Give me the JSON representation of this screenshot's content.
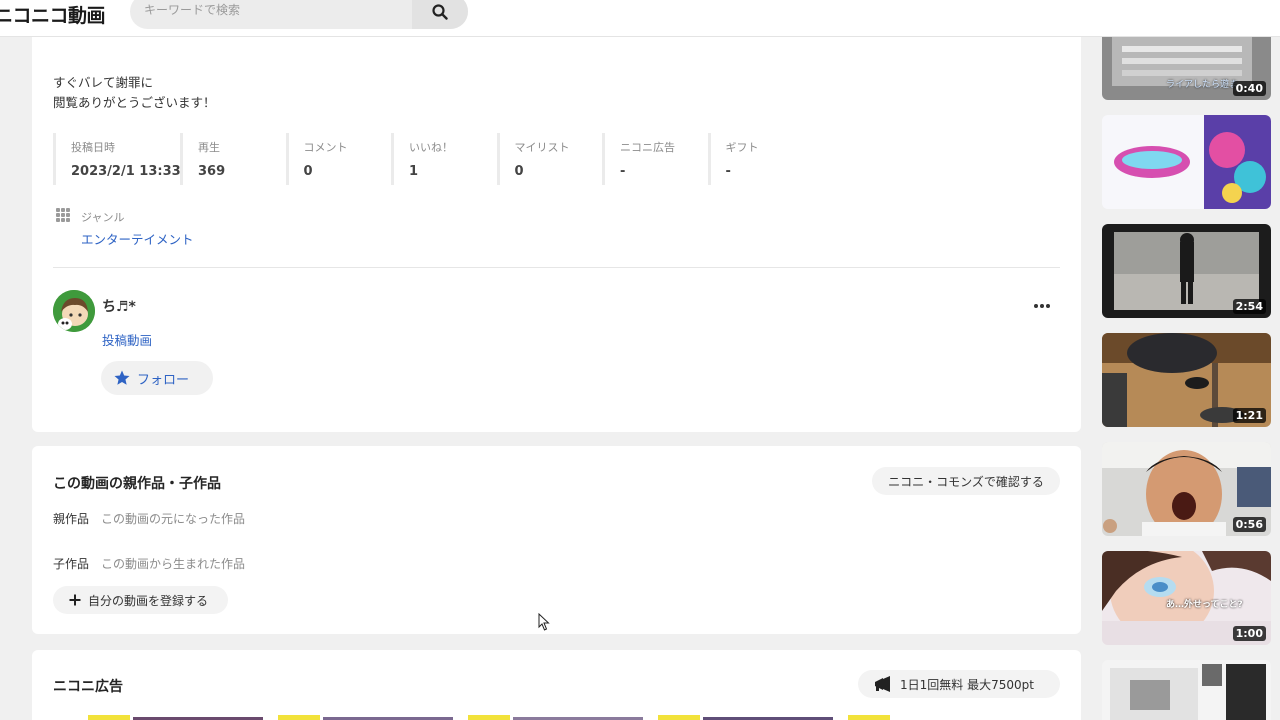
{
  "header": {
    "logo": "ニコニコ動画",
    "search_placeholder": "キーワードで検索"
  },
  "video": {
    "description": [
      "すぐバレて謝罪に",
      "閲覧ありがとうございます！"
    ],
    "stats": [
      {
        "label": "投稿日時",
        "value": "2023/2/1 13:33"
      },
      {
        "label": "再生",
        "value": "369"
      },
      {
        "label": "コメント",
        "value": "0"
      },
      {
        "label": "いいね！",
        "value": "1"
      },
      {
        "label": "マイリスト",
        "value": "0"
      },
      {
        "label": "ニコニ広告",
        "value": "-"
      },
      {
        "label": "ギフト",
        "value": "-"
      }
    ],
    "genre_label": "ジャンル",
    "genre": "エンターテイメント"
  },
  "owner": {
    "name": "ち♬*",
    "videos_link": "投稿動画",
    "follow_label": "フォロー"
  },
  "relations": {
    "title": "この動画の親作品・子作品",
    "commons_button": "ニコニ・コモンズで確認する",
    "parent_label": "親作品",
    "parent_desc": "この動画の元になった作品",
    "child_label": "子作品",
    "child_desc": "この動画から生まれた作品",
    "register_button": "自分の動画を登録する"
  },
  "nicoad": {
    "title": "ニコニ広告",
    "button": "1日1回無料 最大7500pt"
  },
  "sidebar_videos": [
    {
      "duration": "0:40",
      "overlay": "ライアしたら遊ま"
    },
    {
      "duration": "",
      "overlay": ""
    },
    {
      "duration": "2:54",
      "overlay": ""
    },
    {
      "duration": "1:21",
      "overlay": ""
    },
    {
      "duration": "0:56",
      "overlay": ""
    },
    {
      "duration": "1:00",
      "overlay": "あ…外せってこと?"
    },
    {
      "duration": "",
      "overlay": ""
    }
  ],
  "colors": {
    "link": "#2e63c4",
    "page_bg": "#f0f0f0"
  }
}
